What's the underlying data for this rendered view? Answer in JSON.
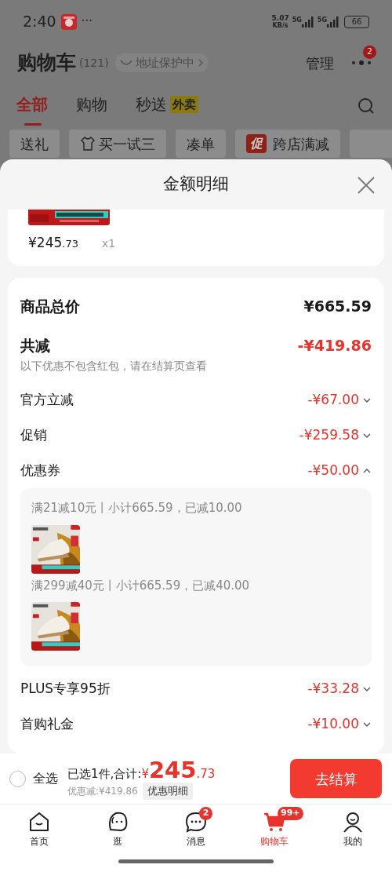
{
  "status_bar": {
    "time": "2:40",
    "more": "···",
    "net_speed": "5.07",
    "net_unit": "KB/s",
    "sim_1": "5G",
    "sim_2": "5G",
    "battery": "66"
  },
  "header": {
    "title": "购物车",
    "count": "(121)",
    "address": "地址保护中",
    "manage": "管理",
    "more_badge": "2"
  },
  "tabs": [
    {
      "label": "全部",
      "selected": true
    },
    {
      "label": "购物",
      "selected": false
    },
    {
      "label": "秒送",
      "selected": false,
      "tag": "外卖"
    }
  ],
  "chips": [
    {
      "label": "送礼"
    },
    {
      "label": "买一试三",
      "kind": "shirt"
    },
    {
      "label": "凑单"
    },
    {
      "label": "跨店满减",
      "kind": "promo",
      "badge": "促"
    }
  ],
  "sheet": {
    "title": "金额明细",
    "item": {
      "price_main": "¥245",
      "price_decimal": ".73",
      "quantity": "x1"
    },
    "rows": [
      {
        "kind": "total",
        "label": "商品总价",
        "amount": "¥665.59"
      },
      {
        "kind": "discount_total",
        "label": "共减",
        "amount": "-¥419.86",
        "note": "以下优惠不包含红包，请在结算页查看"
      },
      {
        "kind": "discount",
        "label": "官方立减",
        "amount": "-¥67.00",
        "expanded": false
      },
      {
        "kind": "discount",
        "label": "促销",
        "amount": "-¥259.58",
        "expanded": false
      },
      {
        "kind": "discount",
        "label": "优惠券",
        "amount": "-¥50.00",
        "expanded": true,
        "coupons": [
          {
            "text": "满21减10元丨小计665.59，已减10.00"
          },
          {
            "text": "满299减40元丨小计665.59，已减40.00"
          }
        ]
      },
      {
        "kind": "discount",
        "label": "PLUS专享95折",
        "amount": "-¥33.28",
        "expanded": false
      },
      {
        "kind": "discount",
        "label": "首购礼金",
        "amount": "-¥10.00",
        "expanded": false
      }
    ]
  },
  "checkout": {
    "select_all": "全选",
    "select_all_checked": false,
    "summary": "已选1件,合计:",
    "total_symbol": "¥",
    "total_main": "245",
    "total_decimal": ".73",
    "discount": "优惠减:¥419.86",
    "detail_button": "优惠明细",
    "checkout_button": "去结算"
  },
  "nav": [
    {
      "label": "首页",
      "kind": "home",
      "selected": false
    },
    {
      "label": "逛",
      "kind": "browse",
      "selected": false
    },
    {
      "label": "消息",
      "kind": "message",
      "selected": false,
      "badge": "2"
    },
    {
      "label": "购物车",
      "kind": "cart",
      "selected": true,
      "badge": "99+"
    },
    {
      "label": "我的",
      "kind": "me",
      "selected": false
    }
  ]
}
